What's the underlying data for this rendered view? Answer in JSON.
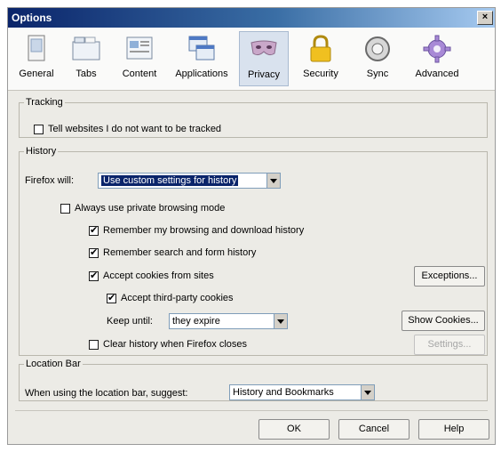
{
  "window": {
    "title": "Options",
    "close_glyph": "×"
  },
  "toolbar": {
    "panes": [
      {
        "label": "General",
        "icon": "general-icon"
      },
      {
        "label": "Tabs",
        "icon": "tabs-icon"
      },
      {
        "label": "Content",
        "icon": "content-icon"
      },
      {
        "label": "Applications",
        "icon": "applications-icon"
      },
      {
        "label": "Privacy",
        "icon": "privacy-mask-icon",
        "selected": true
      },
      {
        "label": "Security",
        "icon": "padlock-icon"
      },
      {
        "label": "Sync",
        "icon": "sync-icon"
      },
      {
        "label": "Advanced",
        "icon": "gear-icon"
      }
    ]
  },
  "tracking": {
    "legend": "Tracking",
    "do_not_track_label": "Tell websites I do not want to be tracked",
    "do_not_track_checked": false
  },
  "history": {
    "legend": "History",
    "firefox_will_label": "Firefox will:",
    "firefox_will_value": "Use custom settings for history",
    "private_browsing_label": "Always use private browsing mode",
    "private_browsing_checked": false,
    "remember_browsing_label": "Remember my browsing and download history",
    "remember_browsing_checked": true,
    "remember_search_label": "Remember search and form history",
    "remember_search_checked": true,
    "accept_cookies_label": "Accept cookies from sites",
    "accept_cookies_checked": true,
    "exceptions_button": "Exceptions...",
    "third_party_label": "Accept third-party cookies",
    "third_party_checked": true,
    "keep_until_label": "Keep until:",
    "keep_until_value": "they expire",
    "show_cookies_button": "Show Cookies...",
    "clear_history_label": "Clear history when Firefox closes",
    "clear_history_checked": false,
    "settings_button": "Settings..."
  },
  "location_bar": {
    "legend": "Location Bar",
    "suggest_label": "When using the location bar, suggest:",
    "suggest_value": "History and Bookmarks"
  },
  "footer": {
    "ok_button": "OK",
    "cancel_button": "Cancel",
    "help_button": "Help"
  },
  "colors": {
    "title_bar": "#0a246a",
    "dialog_bg": "#ecebe6",
    "selected_pane": "#d9e2ee"
  }
}
